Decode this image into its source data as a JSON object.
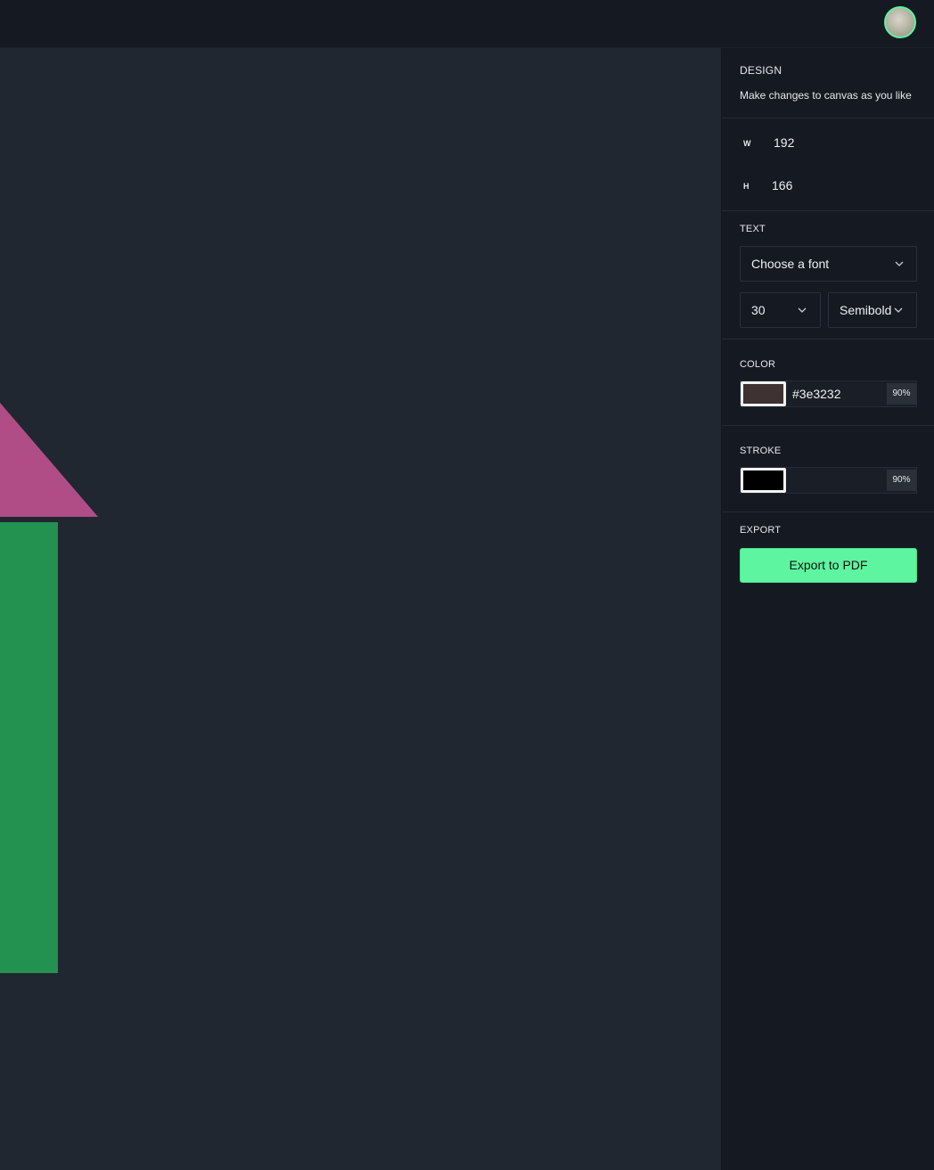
{
  "topbar": {
    "avatar_icon": "user-avatar-icon"
  },
  "panel": {
    "design": {
      "title": "DESIGN",
      "subtitle": "Make changes to canvas as you like"
    },
    "dimensions": {
      "width_label": "W",
      "width_value": "192",
      "height_label": "H",
      "height_value": "166"
    },
    "text": {
      "title": "TEXT",
      "font_select": "Choose a font",
      "size_select": "30",
      "weight_select": "Semibold"
    },
    "color": {
      "title": "COLOR",
      "hex": "#3e3232",
      "opacity": "90%",
      "swatch_color": "#3e3232"
    },
    "stroke": {
      "title": "STROKE",
      "hex": "",
      "opacity": "90%",
      "swatch_color": "#000000"
    },
    "export": {
      "title": "EXPORT",
      "button_label": "Export to PDF"
    }
  },
  "canvas": {
    "shapes": [
      {
        "type": "triangle",
        "fill": "#b04d86"
      },
      {
        "type": "rectangle",
        "fill": "#23914f"
      }
    ]
  },
  "colors": {
    "accent": "#5df5a0",
    "background": "#212731",
    "panel": "#151a22"
  }
}
